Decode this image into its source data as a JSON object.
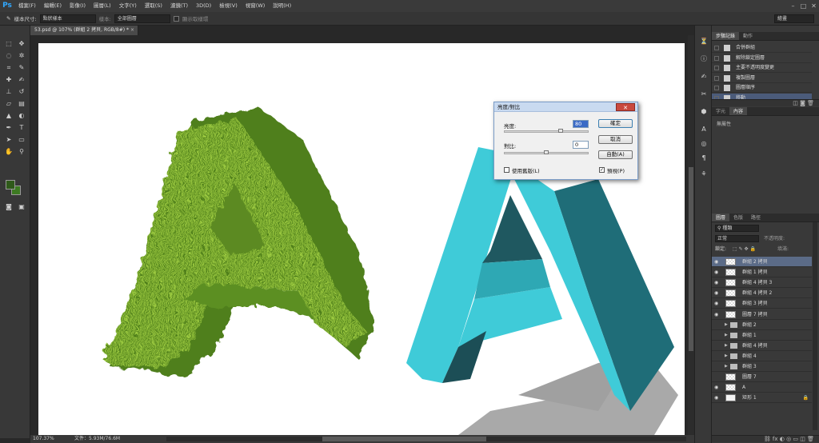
{
  "app": {
    "logo": "Ps"
  },
  "menu": [
    "檔案(F)",
    "編輯(E)",
    "影像(I)",
    "圖層(L)",
    "文字(Y)",
    "選取(S)",
    "濾鏡(T)",
    "3D(D)",
    "檢視(V)",
    "視窗(W)",
    "說明(H)"
  ],
  "window_controls": [
    "–",
    "□",
    "✕"
  ],
  "options": {
    "size_label": "樣本尺寸:",
    "size_value": "點狀樣本",
    "sample_label": "樣本:",
    "sample_value": "全部圖層",
    "ring_label": "顯示取樣環",
    "workspace_value": "繪畫"
  },
  "document": {
    "tab_title": "53.psd @ 107% (群組 2 拷貝, RGB/8#) *",
    "close": "×"
  },
  "status": {
    "zoom": "107.37%",
    "doc_size": "文件：5.93M/76.6M"
  },
  "dialog": {
    "title": "亮度/對比",
    "close": "✕",
    "brightness_label": "亮度:",
    "brightness_value": "80",
    "contrast_label": "對比:",
    "contrast_value": "0",
    "legacy_label": "使用舊版(L)",
    "legacy_checked": false,
    "preview_label": "預視(P)",
    "preview_checked": true,
    "ok": "確定",
    "cancel": "取消",
    "auto": "自動(A)",
    "brightness_level": 0.67,
    "contrast_level": 0.5
  },
  "history_panel": {
    "tabs": [
      "步驟記錄",
      "動作"
    ],
    "items": [
      "合併群組",
      "解除鎖定圖層",
      "主要不透明度變更",
      "複製圖層",
      "圖層順序",
      "移動"
    ],
    "selected_index": 5
  },
  "properties_panel": {
    "tabs": [
      "字元",
      "內容"
    ],
    "empty_text": "無屬性"
  },
  "layers_panel": {
    "tabs": [
      "圖層",
      "色版",
      "路徑"
    ],
    "filter": "種類",
    "blend_mode": "正常",
    "opacity_label": "不透明度:",
    "lock_label": "鎖定:",
    "fill_label": "填滿:",
    "layers": [
      {
        "name": "群組 2 拷貝",
        "type": "layer",
        "selected": true,
        "visible": true
      },
      {
        "name": "群組 1 拷貝",
        "type": "layer",
        "visible": true
      },
      {
        "name": "群組 4 拷貝 3",
        "type": "layer",
        "visible": true
      },
      {
        "name": "群組 4 拷貝 2",
        "type": "layer",
        "visible": true
      },
      {
        "name": "群組 3 拷貝",
        "type": "layer",
        "visible": true
      },
      {
        "name": "圖層 7 拷貝",
        "type": "layer",
        "visible": true
      },
      {
        "name": "群組 2",
        "type": "group",
        "visible": false
      },
      {
        "name": "群組 1",
        "type": "group",
        "visible": false
      },
      {
        "name": "群組 4 拷貝",
        "type": "group",
        "visible": false
      },
      {
        "name": "群組 4",
        "type": "group",
        "visible": false
      },
      {
        "name": "群組 3",
        "type": "group",
        "visible": false
      },
      {
        "name": "圖層 7",
        "type": "layer",
        "visible": false
      },
      {
        "name": "A",
        "type": "layer",
        "visible": true
      },
      {
        "name": "矩形 1",
        "type": "shape",
        "visible": true,
        "locked": true
      }
    ]
  },
  "colors": {
    "grass_dark": "#4f7f1e",
    "grass_light": "#8cbc34",
    "cyan_face": "#3fcbd8",
    "cyan_dark": "#1f6d78",
    "shadow": "#a9a9a9"
  }
}
